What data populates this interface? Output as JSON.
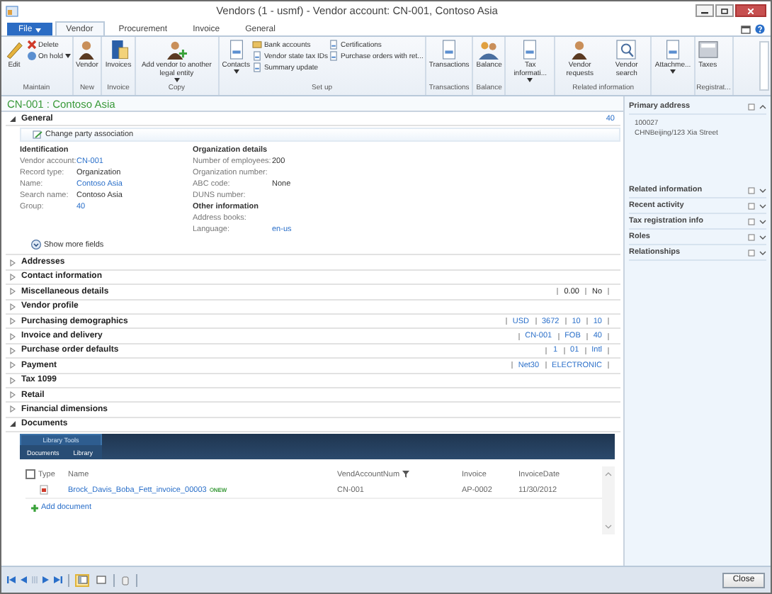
{
  "window": {
    "title": "Vendors (1 - usmf) - Vendor account: CN-001, Contoso Asia"
  },
  "tabs": [
    {
      "label": "File",
      "kind": "file",
      "selected": false
    },
    {
      "label": "Vendor",
      "kind": "tab",
      "selected": true
    },
    {
      "label": "Procurement",
      "kind": "tab",
      "selected": false
    },
    {
      "label": "Invoice",
      "kind": "tab",
      "selected": false
    },
    {
      "label": "General",
      "kind": "tab",
      "selected": false
    }
  ],
  "ribbon": {
    "groups": [
      {
        "label": "Maintain",
        "buttons": [
          {
            "label": "Edit",
            "kind": "large",
            "dropdown": false
          },
          {
            "label": "Delete",
            "kind": "small",
            "dropdown": false
          },
          {
            "label": "On hold",
            "kind": "small",
            "dropdown": true
          }
        ]
      },
      {
        "label": "New",
        "buttons": [
          {
            "label": "Vendor",
            "kind": "large",
            "dropdown": false
          }
        ]
      },
      {
        "label": "Invoice",
        "buttons": [
          {
            "label": "Invoices",
            "kind": "large",
            "dropdown": false
          }
        ]
      },
      {
        "label": "Copy",
        "buttons": [
          {
            "label": "Add vendor to another legal entity",
            "kind": "large",
            "dropdown": true
          }
        ]
      },
      {
        "label": "Set up",
        "buttons": [
          {
            "label": "Contacts",
            "kind": "large",
            "dropdown": true
          },
          {
            "label": "Bank accounts",
            "kind": "small",
            "dropdown": false
          },
          {
            "label": "Vendor state tax IDs",
            "kind": "small",
            "dropdown": false
          },
          {
            "label": "Summary update",
            "kind": "small",
            "dropdown": false
          },
          {
            "label": "Certifications",
            "kind": "small",
            "dropdown": false
          },
          {
            "label": "Purchase orders with ret...",
            "kind": "small",
            "dropdown": false
          }
        ]
      },
      {
        "label": "Transactions",
        "buttons": [
          {
            "label": "Transactions",
            "kind": "large",
            "dropdown": false
          }
        ]
      },
      {
        "label": "Balance",
        "buttons": [
          {
            "label": "Balance",
            "kind": "large",
            "dropdown": false
          }
        ]
      },
      {
        "buttons": [
          {
            "label": "Tax informati...",
            "kind": "large",
            "dropdown": true
          }
        ]
      },
      {
        "label": "Related information",
        "buttons": [
          {
            "label": "Vendor requests",
            "kind": "large",
            "dropdown": false
          },
          {
            "label": "Vendor search",
            "kind": "large",
            "dropdown": false
          }
        ]
      },
      {
        "buttons": [
          {
            "label": "Attachme...",
            "kind": "large",
            "dropdown": true
          }
        ]
      },
      {
        "label": "Registrat...",
        "buttons": [
          {
            "label": "Taxes",
            "kind": "large",
            "dropdown": false
          }
        ]
      }
    ]
  },
  "record_title": "CN-001 : Contoso Asia",
  "fasttabs": [
    {
      "kind": "general",
      "title": "General",
      "expanded": true,
      "count": "40",
      "action": "Change party association",
      "columns": [
        [
          {
            "heading": "Identification",
            "fields": [
              {
                "label": "Vendor account:",
                "value": "CN-001",
                "link": true
              },
              {
                "label": "Record type:",
                "value": "Organization",
                "link": false
              },
              {
                "label": "Name:",
                "value": "Contoso Asia",
                "link": true
              },
              {
                "label": "Search name:",
                "value": "Contoso Asia",
                "link": false
              },
              {
                "label": "Group:",
                "value": "40",
                "link": true
              }
            ]
          }
        ],
        [
          {
            "heading": "Organization details",
            "fields": [
              {
                "label": "Number of employees:",
                "value": "200",
                "link": false
              },
              {
                "label": "Organization number:"
              },
              {
                "label": "ABC code:",
                "value": "None",
                "link": false
              },
              {
                "label": "DUNS number:"
              }
            ]
          },
          {
            "heading": "Other information",
            "fields": [
              {
                "label": "Address books:"
              },
              {
                "label": "Language:",
                "value": "en-us",
                "link": true
              }
            ]
          }
        ]
      ],
      "show_more": "Show more fields"
    },
    {
      "kind": "section",
      "title": "Addresses",
      "expanded": false
    },
    {
      "kind": "section",
      "title": "Contact information",
      "expanded": false
    },
    {
      "kind": "section",
      "title": "Miscellaneous details",
      "expanded": false,
      "summary": [
        {
          "text": "0.00",
          "link": false
        },
        {
          "text": "No",
          "link": false
        }
      ]
    },
    {
      "kind": "section",
      "title": "Vendor profile",
      "expanded": false
    },
    {
      "kind": "section",
      "title": "Purchasing demographics",
      "expanded": false,
      "summary": [
        {
          "text": "USD",
          "link": true
        },
        {
          "text": "3672",
          "link": true
        },
        {
          "text": "10",
          "link": true
        },
        {
          "text": "10",
          "link": true
        }
      ]
    },
    {
      "kind": "section",
      "title": "Invoice and delivery",
      "expanded": false,
      "summary": [
        {
          "text": "CN-001",
          "link": true
        },
        {
          "text": "FOB",
          "link": true
        },
        {
          "text": "40",
          "link": true
        }
      ]
    },
    {
      "kind": "section",
      "title": "Purchase order defaults",
      "expanded": false,
      "summary": [
        {
          "text": "1",
          "link": true
        },
        {
          "text": "01",
          "link": true
        },
        {
          "text": "Intl",
          "link": true
        }
      ]
    },
    {
      "kind": "section",
      "title": "Payment",
      "expanded": false,
      "summary": [
        {
          "text": "Net30",
          "link": true
        },
        {
          "text": "ELECTRONIC",
          "link": true
        }
      ]
    },
    {
      "kind": "section",
      "title": "Tax 1099",
      "expanded": false
    },
    {
      "kind": "section",
      "title": "Retail",
      "expanded": false
    },
    {
      "kind": "section",
      "title": "Financial dimensions",
      "expanded": false
    },
    {
      "kind": "documents",
      "title": "Documents",
      "expanded": true,
      "tool_group": "Library Tools",
      "tool_tabs": [
        {
          "label": "Documents",
          "selected": false
        },
        {
          "label": "Library",
          "selected": false
        }
      ],
      "all_checked": false,
      "columns": [
        "Type",
        "Name",
        "VendAccountNum",
        "Invoice",
        "InvoiceDate"
      ],
      "rows": [
        {
          "name": "Brock_Davis_Boba_Fett_invoice_00003",
          "badge": "NEW",
          "account": "CN-001",
          "invoice": "AP-0002",
          "date": "11/30/2012"
        }
      ],
      "add": "Add document"
    }
  ],
  "factboxes": [
    {
      "title": "Primary address",
      "expanded": true,
      "lines": [
        "100027",
        "CHNBeijing/123 Xia Street"
      ]
    },
    {
      "title": "Related information",
      "expanded": false
    },
    {
      "title": "Recent activity",
      "expanded": false
    },
    {
      "title": "Tax registration info",
      "expanded": false
    },
    {
      "title": "Roles",
      "expanded": false
    },
    {
      "title": "Relationships",
      "expanded": false
    }
  ],
  "view_modes": [
    {
      "selected": true
    },
    {
      "selected": false
    }
  ],
  "close_button": "Close"
}
